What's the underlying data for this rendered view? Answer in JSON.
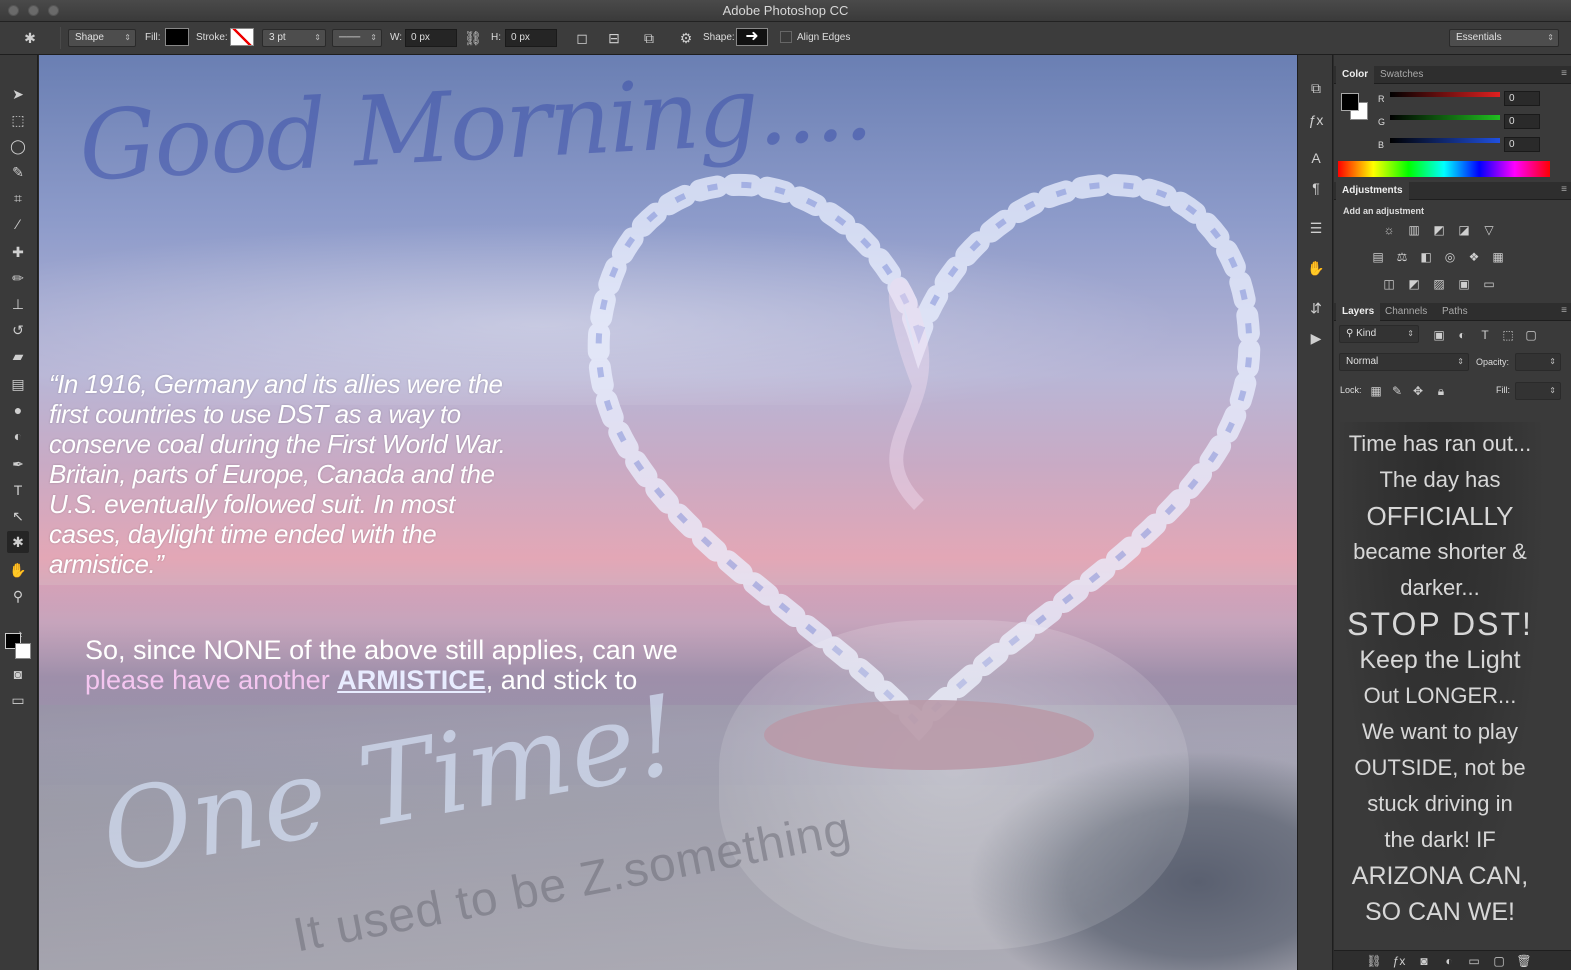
{
  "window": {
    "title": "Adobe Photoshop CC"
  },
  "options": {
    "mode": "Shape",
    "fill_label": "Fill:",
    "stroke_label": "Stroke:",
    "stroke_width": "3 pt",
    "w_label": "W:",
    "w_value": "0 px",
    "h_label": "H:",
    "h_value": "0 px",
    "shape_label": "Shape:",
    "align_edges": "Align Edges",
    "workspace": "Essentials"
  },
  "color_panel": {
    "tabs": [
      "Color",
      "Swatches"
    ],
    "channels": [
      {
        "label": "R",
        "value": "0",
        "color": "#e02020"
      },
      {
        "label": "G",
        "value": "0",
        "color": "#20c020"
      },
      {
        "label": "B",
        "value": "0",
        "color": "#2050e0"
      }
    ]
  },
  "adjustments_panel": {
    "title": "Adjustments",
    "subtitle": "Add an adjustment"
  },
  "layers_panel": {
    "tabs": [
      "Layers",
      "Channels",
      "Paths"
    ],
    "kind": "Kind",
    "blend": "Normal",
    "opacity_label": "Opacity:",
    "lock_label": "Lock:",
    "fill_label": "Fill:",
    "note_lines": [
      "Time has ran out...",
      "The day has",
      "OFFICIALLY",
      "became shorter &",
      "darker...",
      "STOP DST!",
      "Keep the Light",
      "Out LONGER...",
      "We want to play",
      "OUTSIDE, not be",
      "stuck driving in",
      "the dark! IF",
      "ARIZONA CAN,",
      "SO CAN WE!"
    ]
  },
  "canvas": {
    "heading": "Good Morning....",
    "quote": "“In 1916, Germany and its allies were the first countries to use DST as a way to conserve coal during the First World War. Britain, parts of Europe, Canada and the U.S. eventually followed suit. In most cases, daylight time ended with the armistice.”",
    "plea_line1": "So, since NONE of the above still applies, can we",
    "plea_line2_pre": "please have another ",
    "plea_armistice": "ARMISTICE",
    "plea_line2_post": ", and stick to",
    "one_time": "One Time!",
    "used_to_be": "It used to be Z.something"
  }
}
